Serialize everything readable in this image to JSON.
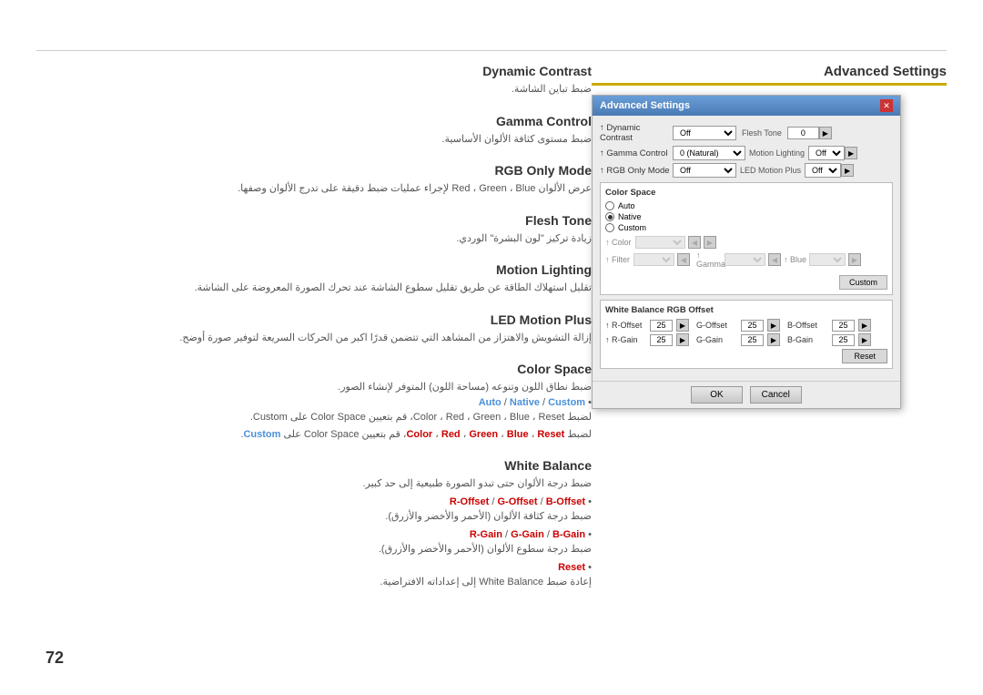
{
  "page": {
    "number": "72",
    "top_border": true
  },
  "advanced_settings": {
    "title": "Advanced Settings",
    "dialog_title": "Advanced Settings"
  },
  "sections": [
    {
      "id": "dynamic-contrast",
      "title": "Dynamic Contrast",
      "desc_arabic": "ضبط تباين الشاشة."
    },
    {
      "id": "gamma-control",
      "title": "Gamma Control",
      "desc_arabic": "ضبط مستوى كثافة الألوان الأساسية."
    },
    {
      "id": "rgb-only-mode",
      "title": "RGB Only Mode",
      "desc_arabic": "عرض الألوان Red ، Green ، Blue لإجراء عمليات ضبط دقيقة على تدرج الألوان وصفها."
    },
    {
      "id": "flesh-tone",
      "title": "Flesh Tone",
      "desc_arabic": "زيادة تركيز \"لون البشرة\" الوردي."
    },
    {
      "id": "motion-lighting",
      "title": "Motion Lighting",
      "desc_arabic": "تقليل استهلاك الطاقة عن طريق تقليل سطوع الشاشة عند تحرك الصورة المعروضة على الشاشة."
    },
    {
      "id": "led-motion-plus",
      "title": "LED Motion Plus",
      "desc_arabic": "إزالة التشويش والاهتزاز من المشاهد التي تتضمن قدرًا اكبر من الحركات السريعة لتوفير صورة أوضح."
    },
    {
      "id": "color-space",
      "title": "Color Space",
      "desc_arabic": "ضبط نطاق اللون وتنوعه (مساحة اللون) المتوفر لإنشاء الصور.",
      "note_line1_pre": "Auto",
      "note_line1_sep1": " / ",
      "note_line1_native": "Native",
      "note_line1_sep2": " / ",
      "note_line1_custom": "Custom",
      "note_line1_suffix": " •",
      "note_line2_arabic": "لضبط Color ، Red ، Green ، Blue ، Reset، قم بتعيين Color Space على Custom."
    },
    {
      "id": "white-balance",
      "title": "White Balance",
      "desc_arabic": "ضبط درجة الألوان حتى تبدو الصورة طبيعية إلى حد كبير.",
      "offset_line": "R-Offset / G-Offset / B-Offset •",
      "offset_desc": "ضبط درجة كثافة الألوان (الأحمر والأخضر والأزرق).",
      "gain_line": "R-Gain / G-Gain / B-Gain •",
      "gain_desc": "ضبط درجة سطوع الألوان (الأحمر والأخضر والأزرق).",
      "reset_line": "Reset •",
      "reset_desc": "إعادة ضبط White Balance إلى إعداداته الافتراضية."
    }
  ],
  "dialog": {
    "rows": [
      {
        "label": "Dynamic Contrast",
        "control_type": "select",
        "value": "Off",
        "right_label": "Flesh Tone",
        "right_value": "0"
      },
      {
        "label": "Gamma Control",
        "control_type": "select",
        "value": "0 (Natural)",
        "right_label": "Motion Lighting",
        "right_value": "Off"
      },
      {
        "label": "RGB Only Mode",
        "control_type": "select",
        "value": "Off",
        "right_label": "LED Motion Plus",
        "right_value": "Off"
      }
    ],
    "color_space": {
      "title": "Color Space",
      "options": [
        "Auto",
        "Native",
        "Custom"
      ],
      "selected": "Native",
      "color_label": "Color",
      "filter_label": "Filter",
      "gamma_label": "Gamma",
      "blue_label": "Blue",
      "custom_btn": "Custom"
    },
    "white_balance": {
      "title": "White Balance RGB Offset",
      "r_offset_label": "R-Offset",
      "r_offset_value": "25",
      "g_offset_label": "G-Offset",
      "g_offset_value": "25",
      "b_offset_label": "B-Offset",
      "b_offset_value": "25",
      "r_gain_label": "R-Gain",
      "r_gain_value": "25",
      "g_gain_label": "G-Gain",
      "g_gain_value": "25",
      "b_gain_label": "B-Gain",
      "b_gain_value": "25",
      "reset_label": "Reset"
    },
    "ok_label": "OK",
    "cancel_label": "Cancel"
  }
}
